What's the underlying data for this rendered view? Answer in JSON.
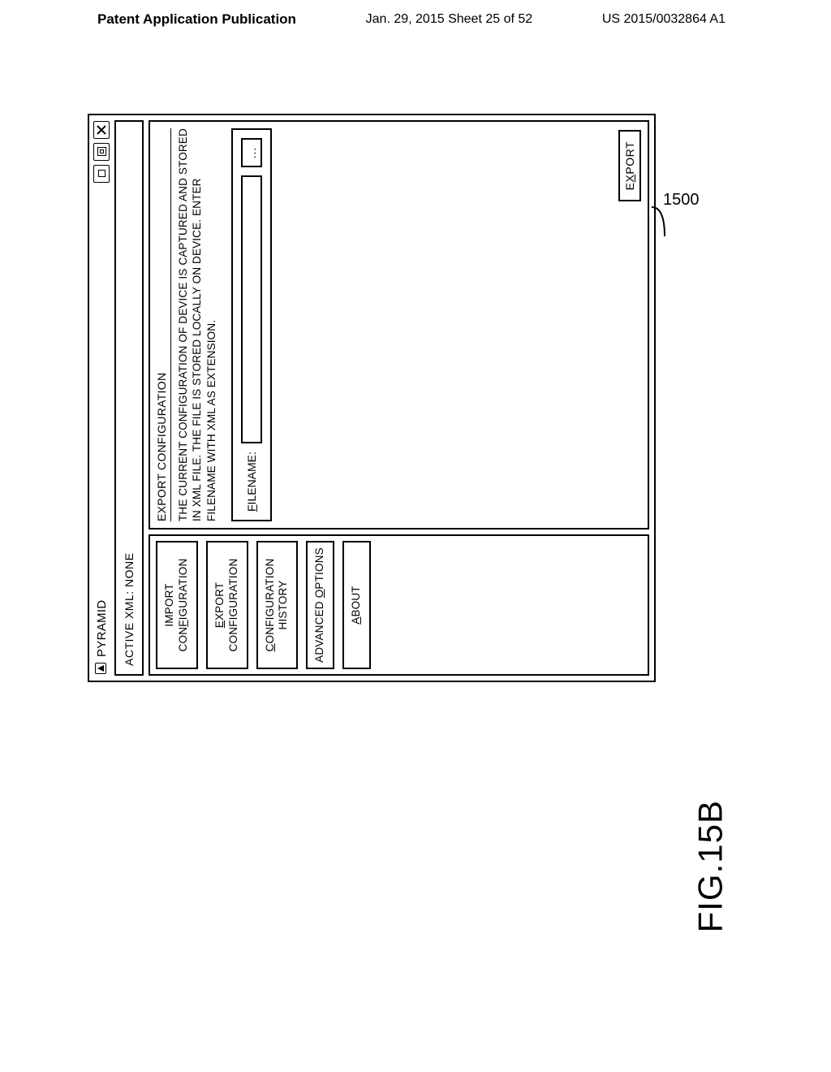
{
  "header": {
    "left": "Patent Application Publication",
    "center": "Jan. 29, 2015  Sheet 25 of 52",
    "right": "US 2015/0032864 A1"
  },
  "window": {
    "title": "PYRAMID",
    "status": "ACTIVE XML: NONE",
    "controls": {
      "min": "minimize",
      "max": "maximize",
      "close": "close"
    }
  },
  "sidebar": {
    "items": [
      {
        "pre": "IMPORT CON",
        "u": "F",
        "post": "IGURATION",
        "selected": false
      },
      {
        "pre": "",
        "u": "E",
        "post": "XPORT CONFIGURATION",
        "selected": true
      },
      {
        "pre": "",
        "u": "C",
        "post": "ONFIGURATION HISTORY",
        "selected": false
      },
      {
        "pre": "ADVANCED ",
        "u": "O",
        "post": "PTIONS",
        "selected": false
      },
      {
        "pre": "",
        "u": "A",
        "post": "BOUT",
        "selected": false
      }
    ]
  },
  "content": {
    "section_title": "EXPORT CONFIGURATION",
    "description": "THE CURRENT CONFIGURATION OF DEVICE IS CAPTURED AND STORED IN XML FILE. THE FILE IS STORED LOCALLY ON DEVICE. ENTER FILENAME WITH XML AS EXTENSION.",
    "filename_label_u": "F",
    "filename_label_rest": "ILENAME:",
    "filename_value": "",
    "browse_label": "...",
    "export_button_pre": "E",
    "export_button_u": "X",
    "export_button_post": "PORT"
  },
  "figure": {
    "ref_number": "1500",
    "label": "FIG.15B"
  }
}
